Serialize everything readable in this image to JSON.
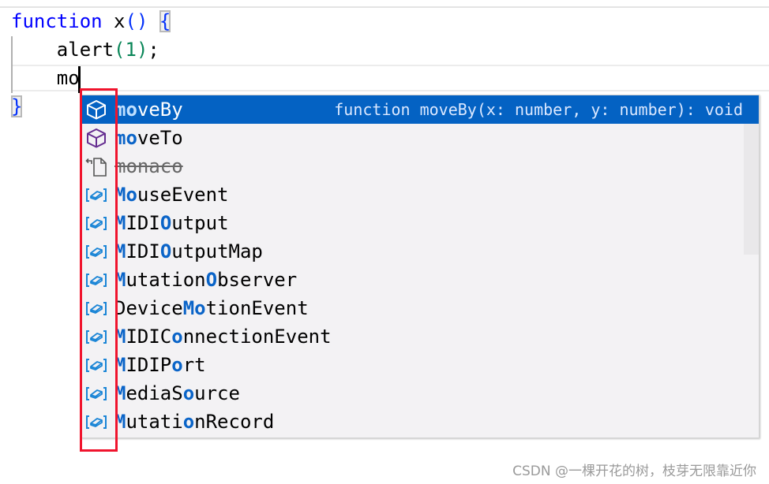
{
  "editor": {
    "lines": [
      {
        "kw": "function",
        "rest": " x",
        "paren": "()",
        "sp": " ",
        "brace": "{"
      },
      {
        "indent": "    ",
        "ident": "alert",
        "open": "(",
        "num": "1",
        "close": ")",
        "semi": ";"
      },
      {
        "indent": "    ",
        "text": "mo"
      },
      {
        "brace": "}"
      }
    ]
  },
  "suggest": {
    "selected_detail": "function moveBy(x: number, y: number): void",
    "items": [
      {
        "icon": "method-icon",
        "segments": [
          [
            "mo",
            true
          ],
          [
            "veBy",
            false
          ]
        ],
        "selected": true
      },
      {
        "icon": "method-icon",
        "segments": [
          [
            "mo",
            true
          ],
          [
            "veTo",
            false
          ]
        ]
      },
      {
        "icon": "module-icon",
        "segments": [
          [
            "monaco",
            false
          ]
        ],
        "deprecated": true
      },
      {
        "icon": "class-icon",
        "segments": [
          [
            "Mo",
            true
          ],
          [
            "useEvent",
            false
          ]
        ]
      },
      {
        "icon": "class-icon",
        "segments": [
          [
            "M",
            true
          ],
          [
            "IDI",
            false
          ],
          [
            "O",
            true
          ],
          [
            "utput",
            false
          ]
        ]
      },
      {
        "icon": "class-icon",
        "segments": [
          [
            "M",
            true
          ],
          [
            "IDI",
            false
          ],
          [
            "O",
            true
          ],
          [
            "utputMap",
            false
          ]
        ]
      },
      {
        "icon": "class-icon",
        "segments": [
          [
            "M",
            true
          ],
          [
            "utation",
            false
          ],
          [
            "O",
            true
          ],
          [
            "bserver",
            false
          ]
        ]
      },
      {
        "icon": "class-icon",
        "segments": [
          [
            "Device",
            false
          ],
          [
            "Mo",
            true
          ],
          [
            "tionEvent",
            false
          ]
        ]
      },
      {
        "icon": "class-icon",
        "segments": [
          [
            "M",
            true
          ],
          [
            "IDIC",
            false
          ],
          [
            "o",
            true
          ],
          [
            "nnectionEvent",
            false
          ]
        ]
      },
      {
        "icon": "class-icon",
        "segments": [
          [
            "M",
            true
          ],
          [
            "IDIP",
            false
          ],
          [
            "o",
            true
          ],
          [
            "rt",
            false
          ]
        ]
      },
      {
        "icon": "class-icon",
        "segments": [
          [
            "M",
            true
          ],
          [
            "ediaS",
            false
          ],
          [
            "o",
            true
          ],
          [
            "urce",
            false
          ]
        ]
      },
      {
        "icon": "class-icon",
        "segments": [
          [
            "M",
            true
          ],
          [
            "utati",
            false
          ],
          [
            "o",
            true
          ],
          [
            "nRecord",
            false
          ]
        ]
      }
    ]
  },
  "colors": {
    "selection": "#0462c3",
    "highlight": "#0a64c8",
    "method_icon": "#652d90",
    "class_icon": "#1a85d6",
    "annotation_box": "#f0142d"
  },
  "watermark": "CSDN @一棵开花的树，枝芽无限靠近你"
}
